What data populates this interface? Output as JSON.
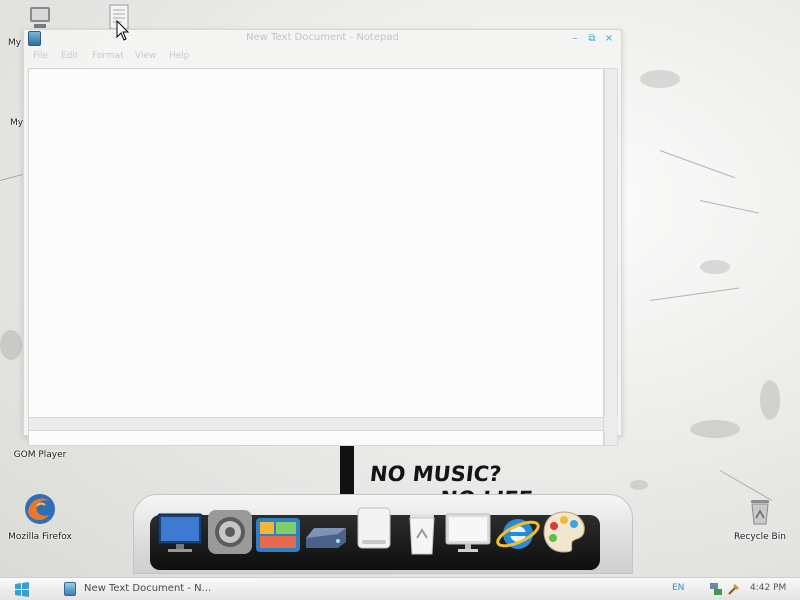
{
  "desktop": {
    "icons": [
      {
        "label": "My",
        "icon": "my-computer-icon"
      },
      {
        "label": "My",
        "icon": "my-documents-icon"
      },
      {
        "label": "GOM Player",
        "icon": "gom-player-icon"
      },
      {
        "label": "Mozilla Firefox",
        "icon": "firefox-icon"
      },
      {
        "label": "Recycle Bin",
        "icon": "recycle-bin-icon"
      },
      {
        "label": "",
        "icon": "text-file-icon"
      }
    ],
    "wallpaper_text": [
      "NO MUSIC?",
      "NO LIFE."
    ]
  },
  "notepad": {
    "title": "New Text Document - Notepad",
    "menu": [
      "File",
      "Edit",
      "Format",
      "View",
      "Help"
    ],
    "content": "",
    "controls": {
      "minimize": "–",
      "maximize": "⧉",
      "close": "×"
    }
  },
  "dock": {
    "items": [
      {
        "icon": "monitor-icon"
      },
      {
        "icon": "system-preferences-icon"
      },
      {
        "icon": "photo-gallery-icon"
      },
      {
        "icon": "hard-drive-icon"
      },
      {
        "icon": "removable-drive-icon"
      },
      {
        "icon": "trash-icon"
      },
      {
        "icon": "display-icon"
      },
      {
        "icon": "internet-explorer-icon"
      },
      {
        "icon": "paint-palette-icon"
      }
    ]
  },
  "taskbar": {
    "start_icon": "windows-logo-icon",
    "task_label": "New Text Document - N...",
    "language": "EN",
    "clock": "4:42 PM"
  },
  "colors": {
    "accent": "#3aa5c8",
    "taskbar": "#eeeeee",
    "drip": "#111111"
  }
}
